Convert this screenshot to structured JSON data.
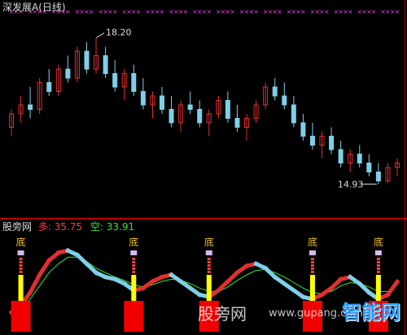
{
  "header": {
    "title": "深发展A(日线)"
  },
  "indicator": {
    "name": "股旁网",
    "duo_label": "多",
    "duo_value": "35.75",
    "kong_label": "空",
    "kong_value": "33.91"
  },
  "watermark": {
    "main": "股旁网",
    "domain": "www.gupang.com",
    "logo": "智能网"
  },
  "colors": {
    "up": "#e03030",
    "down": "#7fcfe8",
    "cross": "#d04ad0",
    "green_line": "#2ee82e",
    "bottom_bar": "#f00000",
    "bottom_stem": "#ffff00",
    "label": "#f0c020"
  },
  "chart_data": [
    {
      "type": "candlestick",
      "title": "深发展A(日线)",
      "annotations": [
        {
          "text": "18.20",
          "kind": "high"
        },
        {
          "text": "14.93",
          "kind": "low"
        }
      ],
      "ylim": [
        14.5,
        18.5
      ],
      "series": [
        {
          "values": [
            [
              16.2,
              16.6,
              16.0,
              16.5
            ],
            [
              16.5,
              16.9,
              16.3,
              16.7
            ],
            [
              16.7,
              17.1,
              16.4,
              16.6
            ],
            [
              16.6,
              17.3,
              16.5,
              17.2
            ],
            [
              17.2,
              17.5,
              16.9,
              17.0
            ],
            [
              17.0,
              17.6,
              16.9,
              17.5
            ],
            [
              17.5,
              17.8,
              17.2,
              17.3
            ],
            [
              17.3,
              18.0,
              17.2,
              17.9
            ],
            [
              17.9,
              18.1,
              17.4,
              17.5
            ],
            [
              17.5,
              18.2,
              17.4,
              17.8
            ],
            [
              17.8,
              18.0,
              17.3,
              17.4
            ],
            [
              17.4,
              17.7,
              17.0,
              17.1
            ],
            [
              17.1,
              17.5,
              16.8,
              17.4
            ],
            [
              17.4,
              17.6,
              16.9,
              17.0
            ],
            [
              17.0,
              17.3,
              16.6,
              16.7
            ],
            [
              16.7,
              17.0,
              16.4,
              16.9
            ],
            [
              16.9,
              17.1,
              16.5,
              16.6
            ],
            [
              16.6,
              16.9,
              16.2,
              16.3
            ],
            [
              16.3,
              16.8,
              16.1,
              16.7
            ],
            [
              16.7,
              17.0,
              16.5,
              16.6
            ],
            [
              16.6,
              16.8,
              16.2,
              16.3
            ],
            [
              16.3,
              16.6,
              16.0,
              16.5
            ],
            [
              16.5,
              16.9,
              16.4,
              16.8
            ],
            [
              16.8,
              17.0,
              16.3,
              16.4
            ],
            [
              16.4,
              16.7,
              16.1,
              16.2
            ],
            [
              16.2,
              16.5,
              15.9,
              16.4
            ],
            [
              16.4,
              16.8,
              16.3,
              16.7
            ],
            [
              16.7,
              17.2,
              16.6,
              17.1
            ],
            [
              17.1,
              17.3,
              16.8,
              16.9
            ],
            [
              16.9,
              17.2,
              16.6,
              16.7
            ],
            [
              16.7,
              16.9,
              16.2,
              16.3
            ],
            [
              16.3,
              16.5,
              15.9,
              16.0
            ],
            [
              16.0,
              16.3,
              15.7,
              15.8
            ],
            [
              15.8,
              16.1,
              15.5,
              16.0
            ],
            [
              16.0,
              16.2,
              15.6,
              15.7
            ],
            [
              15.7,
              15.9,
              15.3,
              15.4
            ],
            [
              15.4,
              15.7,
              15.2,
              15.6
            ],
            [
              15.6,
              15.8,
              15.3,
              15.4
            ],
            [
              15.4,
              15.6,
              15.1,
              15.2
            ],
            [
              15.2,
              15.4,
              14.93,
              15.0
            ],
            [
              15.0,
              15.4,
              14.95,
              15.3
            ],
            [
              15.3,
              15.5,
              15.1,
              15.4
            ]
          ]
        }
      ]
    },
    {
      "type": "line",
      "title": "股旁网",
      "legend": [
        "多 35.75",
        "空 33.91"
      ],
      "series": [
        {
          "name": "多",
          "values": [
            8,
            14,
            26,
            42,
            55,
            62,
            64,
            60,
            52,
            44,
            40,
            38,
            34,
            28,
            30,
            36,
            40,
            42,
            36,
            30,
            24,
            22,
            28,
            36,
            44,
            50,
            52,
            48,
            40,
            34,
            28,
            22,
            20,
            24,
            30,
            38,
            40,
            34,
            26,
            20,
            24,
            35.75
          ]
        },
        {
          "name": "空",
          "values": [
            10,
            12,
            20,
            32,
            44,
            52,
            58,
            58,
            54,
            48,
            44,
            40,
            37,
            33,
            31,
            33,
            36,
            38,
            37,
            34,
            30,
            27,
            27,
            31,
            37,
            42,
            46,
            47,
            44,
            40,
            35,
            30,
            26,
            25,
            27,
            32,
            35,
            34,
            31,
            27,
            27,
            33.91
          ]
        }
      ],
      "markers": [
        {
          "text": "底",
          "stem": "bottom"
        },
        {
          "text": "底",
          "stem": "bottom"
        },
        {
          "text": "底",
          "stem": "bottom"
        },
        {
          "text": "底",
          "stem": "bottom"
        },
        {
          "text": "底",
          "stem": "bottom"
        }
      ]
    }
  ]
}
